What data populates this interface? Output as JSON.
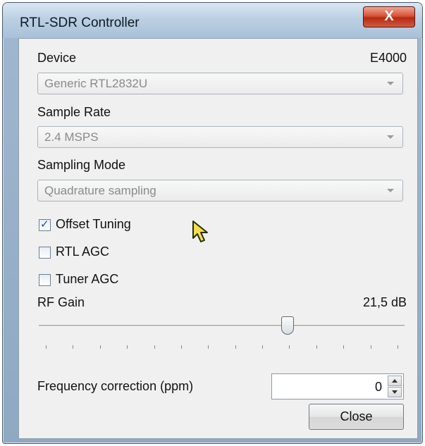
{
  "window": {
    "title": "RTL-SDR Controller",
    "close_glyph": "X"
  },
  "device": {
    "label": "Device",
    "tuner": "E4000",
    "selected": "Generic RTL2832U"
  },
  "sample_rate": {
    "label": "Sample Rate",
    "selected": "2.4 MSPS"
  },
  "sampling_mode": {
    "label": "Sampling Mode",
    "selected": "Quadrature sampling"
  },
  "options": {
    "offset_tuning": {
      "label": "Offset Tuning",
      "checked": true
    },
    "rtl_agc": {
      "label": "RTL AGC",
      "checked": false
    },
    "tuner_agc": {
      "label": "Tuner AGC",
      "checked": false
    }
  },
  "rf_gain": {
    "label": "RF Gain",
    "value_text": "21,5 dB",
    "slider_fraction": 0.68,
    "tick_count": 14
  },
  "frequency_correction": {
    "label": "Frequency correction (ppm)",
    "value": "0"
  },
  "close_button": {
    "label": "Close"
  },
  "colors": {
    "titlebar": "#bcd0e3",
    "close_x": "#c8432c",
    "client_bg": "#f0f0f0"
  },
  "icons": [
    "close-icon",
    "chevron-down-icon",
    "checkmark-icon",
    "arrow-up-icon",
    "arrow-down-icon",
    "mouse-cursor-icon"
  ]
}
